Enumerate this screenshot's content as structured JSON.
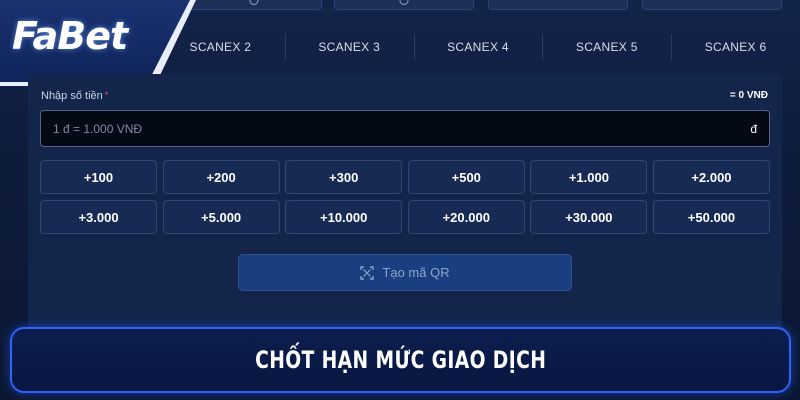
{
  "brand": {
    "logo_text": "FaBet"
  },
  "tabs": [
    "SCANEX 2",
    "SCANEX 3",
    "SCANEX 4",
    "SCANEX 5",
    "SCANEX 6"
  ],
  "form": {
    "amount_label": "Nhập số tiền",
    "required_mark": "*",
    "amount_total": "= 0 VNĐ",
    "amount_placeholder": "1 đ = 1.000 VNĐ",
    "currency_symbol": "đ"
  },
  "quick_amounts": [
    "+100",
    "+200",
    "+300",
    "+500",
    "+1.000",
    "+2.000",
    "+3.000",
    "+5.000",
    "+10.000",
    "+20.000",
    "+30.000",
    "+50.000"
  ],
  "qr_button": {
    "label": "Tạo mã QR",
    "icon": "qr-scan-icon"
  },
  "banner": {
    "title": "CHỐT HẠN MỨC GIAO DỊCH"
  },
  "colors": {
    "accent_blue": "#2a63ff",
    "panel": "#14254c",
    "button_disabled": "#1a3f80"
  }
}
